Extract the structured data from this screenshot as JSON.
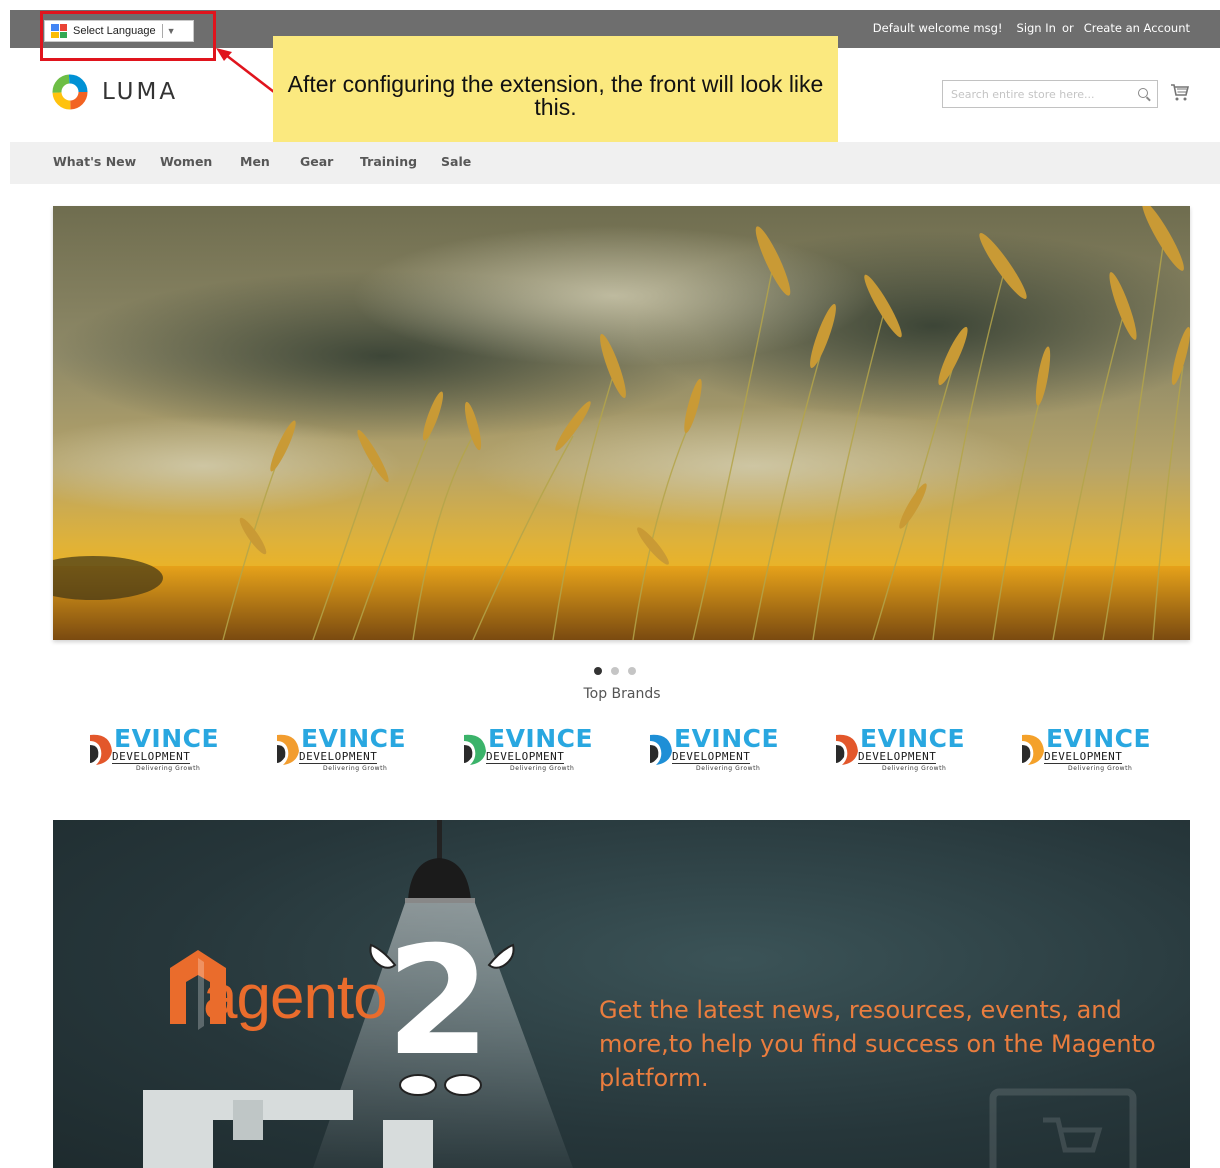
{
  "header_panel": {
    "language_widget": "Select Language",
    "welcome": "Default welcome msg!",
    "sign_in": "Sign In",
    "or": "or",
    "create_account": "Create an Account"
  },
  "callout": {
    "text": "After configuring the extension, the front will look like this."
  },
  "logo": {
    "text": "LUMA"
  },
  "search": {
    "placeholder": "Search entire store here..."
  },
  "nav": {
    "items": [
      "What's New",
      "Women",
      "Men",
      "Gear",
      "Training",
      "Sale"
    ]
  },
  "slider": {
    "dot_count": 3,
    "active_index": 0
  },
  "brands_section": {
    "title": "Top Brands",
    "brands": [
      {
        "name": "EVINCE",
        "sub": "DEVELOPMENT",
        "tag": "Delivering Growth",
        "mark_color": "#e3572b"
      },
      {
        "name": "EVINCE",
        "sub": "DEVELOPMENT",
        "tag": "Delivering Growth",
        "mark_color": "#f29d2f"
      },
      {
        "name": "EVINCE",
        "sub": "DEVELOPMENT",
        "tag": "Delivering Growth",
        "mark_color": "#3bb36a"
      },
      {
        "name": "EVINCE",
        "sub": "DEVELOPMENT",
        "tag": "Delivering Growth",
        "mark_color": "#1e8fd6"
      },
      {
        "name": "EVINCE",
        "sub": "DEVELOPMENT",
        "tag": "Delivering Growth",
        "mark_color": "#e3572b"
      },
      {
        "name": "EVINCE",
        "sub": "DEVELOPMENT",
        "tag": "Delivering Growth",
        "mark_color": "#f4a12a"
      }
    ],
    "name_color": "#29a7e0"
  },
  "promo": {
    "logo_word": "agento",
    "version": "2",
    "text": "Get the latest news, resources, events, and more,to help you find success on the Magento platform."
  },
  "colors": {
    "top_bar": "#6e6e6e",
    "nav_bg": "#f0f0f0",
    "callout_bg": "#fbe97f",
    "annotation_red": "#e0141d",
    "promo_text": "#ea7d3e"
  }
}
